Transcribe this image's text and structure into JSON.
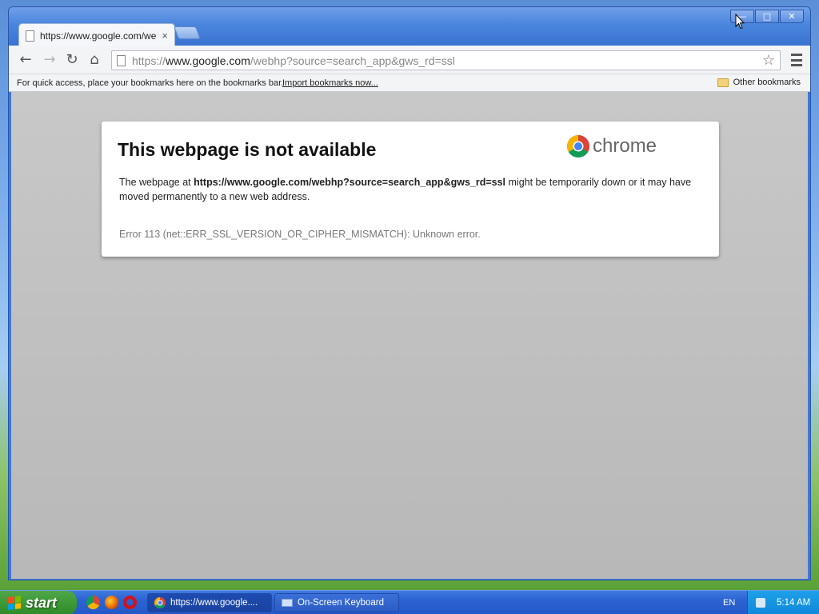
{
  "browser": {
    "tab": {
      "title": "https://www.google.com/we",
      "close": "×"
    },
    "address_bar": {
      "scheme": "https://",
      "host": "www.google.com",
      "path": "/webhp?source=search_app&gws_rd=ssl"
    },
    "bookmarks_bar": {
      "hint": "For quick access, place your bookmarks here on the bookmarks bar.",
      "import_link": "Import bookmarks now...",
      "other_bookmarks": "Other bookmarks"
    }
  },
  "error_page": {
    "title": "This webpage is not available",
    "brand": "chrome",
    "body_prefix": "The webpage at ",
    "body_url": "https://www.google.com/webhp?source=search_app&gws_rd=ssl",
    "body_suffix": " might be temporarily down or it may have moved permanently to a new web address.",
    "error_code": "Error 113 (net::ERR_SSL_VERSION_OR_CIPHER_MISMATCH): Unknown error."
  },
  "taskbar": {
    "start_label": "start",
    "tasks": [
      {
        "label": "https://www.google...."
      },
      {
        "label": "On-Screen Keyboard"
      }
    ],
    "language": "EN",
    "clock": "5:14 AM"
  },
  "colors": {
    "xp_blue": "#3f78d6",
    "start_green": "#3d9a36",
    "page_gray": "#c0c0c0"
  }
}
